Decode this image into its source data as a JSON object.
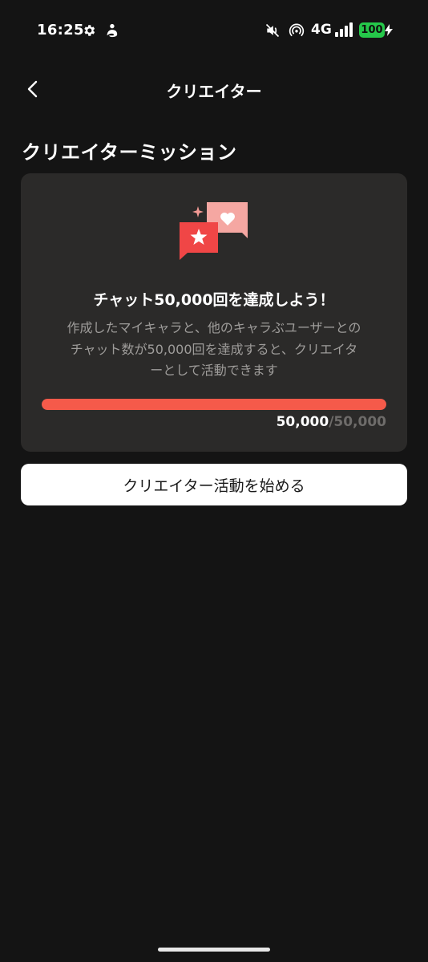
{
  "status_bar": {
    "time": "16:25",
    "network": "4G",
    "battery": "100",
    "icons": [
      "gear-icon",
      "app-notification-icon",
      "mute-icon",
      "hotspot-icon",
      "signal-icon",
      "battery-icon",
      "charging-icon"
    ]
  },
  "header": {
    "title": "クリエイター",
    "back_icon": "chevron-left-icon"
  },
  "section": {
    "title": "クリエイターミッション"
  },
  "mission": {
    "illustration": "chat-bubbles-star-heart-icon",
    "title": "チャット50,000回を達成しよう！",
    "description_lines": [
      "作成したマイキャラと、他のキャラぶユーザーとの",
      "チャット数が50,000回を達成すると、クリエイタ",
      "ーとして活動できます"
    ],
    "progress_current": "50,000",
    "progress_total": "/50,000",
    "progress_fraction": 1.0
  },
  "cta": {
    "label": "クリエイター活動を始める"
  },
  "colors": {
    "background": "#141414",
    "card": "#2b2a29",
    "accent": "#f55a4a",
    "battery": "#25c84a"
  }
}
